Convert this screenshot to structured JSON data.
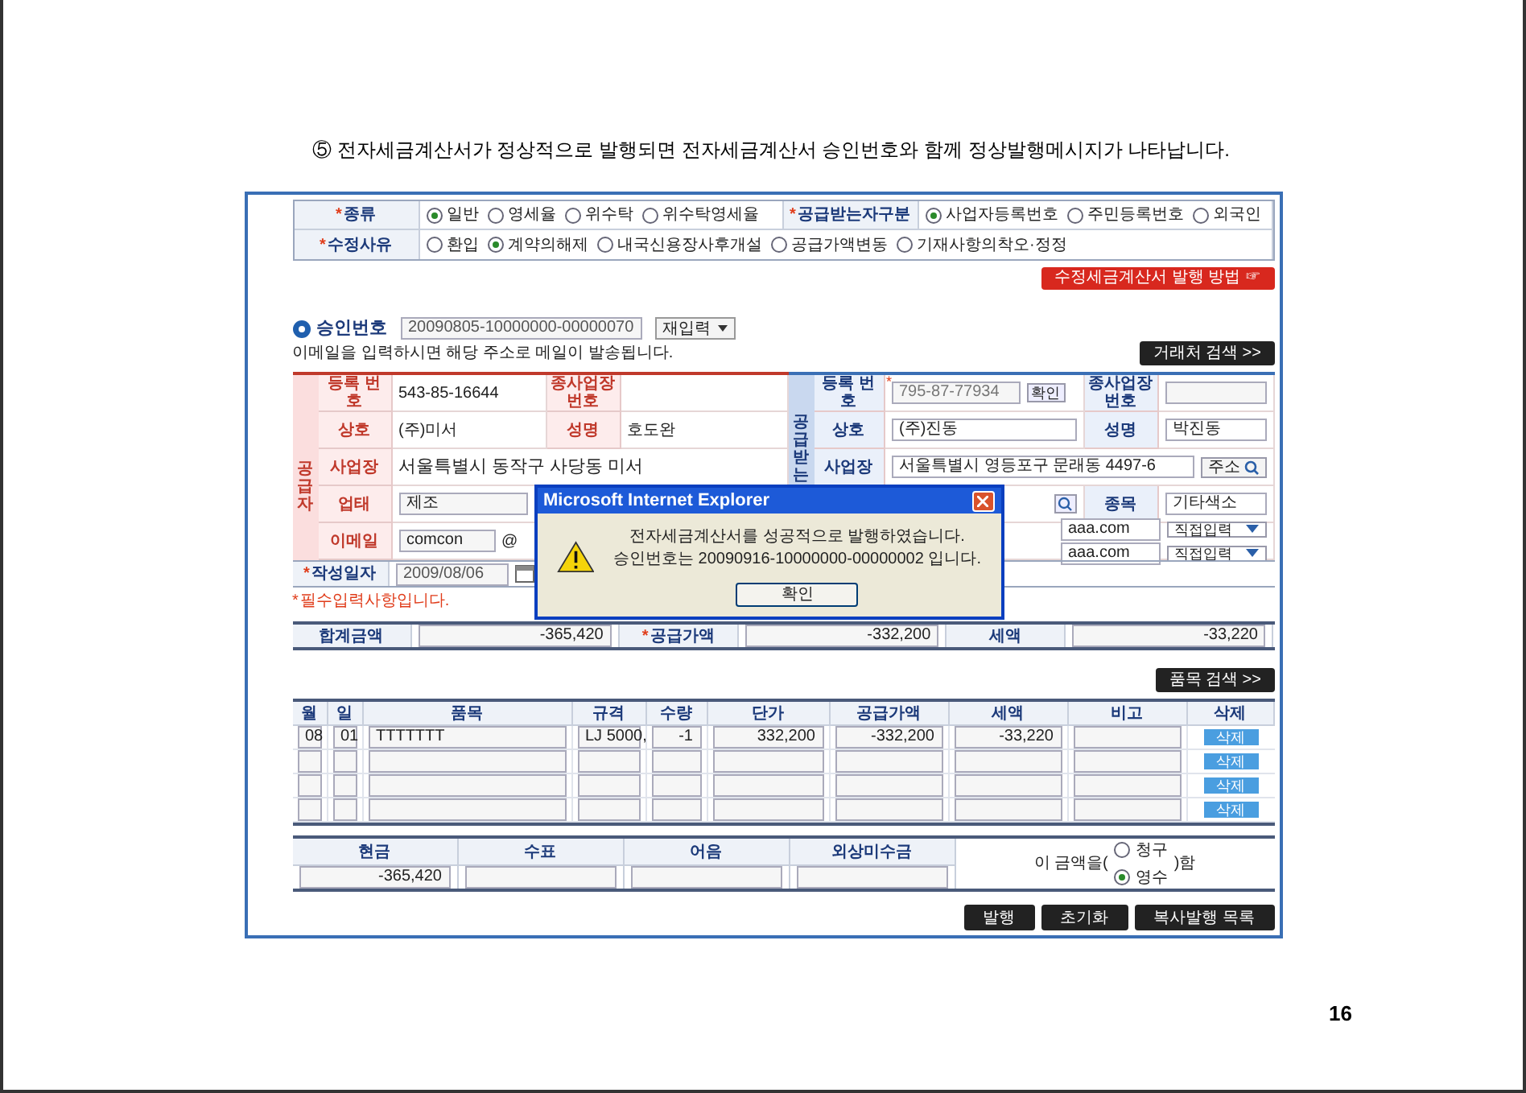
{
  "heading": "⑤ 전자세금계산서가 정상적으로 발행되면 전자세금계산서 승인번호와 함께 정상발행메시지가 나타납니다.",
  "option_rows": [
    {
      "groups": [
        {
          "mark": "*",
          "label": "종류",
          "choices": [
            {
              "label": "일반",
              "selected": true
            },
            {
              "label": "영세율",
              "selected": false
            },
            {
              "label": "위수탁",
              "selected": false
            },
            {
              "label": "위수탁영세율",
              "selected": false
            }
          ]
        },
        {
          "mark": "*",
          "label": "공급받는자구분",
          "choices": [
            {
              "label": "사업자등록번호",
              "selected": true
            },
            {
              "label": "주민등록번호",
              "selected": false
            },
            {
              "label": "외국인",
              "selected": false
            }
          ]
        }
      ]
    },
    {
      "groups": [
        {
          "mark": "*",
          "label": "수정사유",
          "choices": [
            {
              "label": "환입",
              "selected": false
            },
            {
              "label": "계약의해제",
              "selected": true
            },
            {
              "label": "내국신용장사후개설",
              "selected": false
            },
            {
              "label": "공급가액변동",
              "selected": false
            },
            {
              "label": "기재사항의착오·정정",
              "selected": false
            }
          ]
        }
      ]
    }
  ],
  "guide_button": "수정세금계산서 발행 방법 ☞",
  "approval": {
    "label": "승인번호",
    "value": "20090805-10000000-00000070",
    "reissue": "재입력"
  },
  "email_note": "이메일을 입력하시면 해당 주소로 메일이 발송됩니다.",
  "partner_search": "거래처 검색 >>",
  "supplier": {
    "title": "공급자",
    "reg_label": "등록 번호",
    "reg": "543-85-16644",
    "branch_label": "종사업장 번호",
    "name_label": "상호",
    "name": "(주)미서",
    "ceo_label": "성명",
    "ceo": "호도완",
    "addr_label": "사업장",
    "addr": "서울특별시 동작구 사당동 미서",
    "type_label": "업태",
    "type": "제조",
    "email_label": "이메일",
    "email": "comcon",
    "at": "@"
  },
  "receiver": {
    "title": "공급받는",
    "mark": "*",
    "reg_label": "등록 번호",
    "reg": "795-87-77934",
    "confirm": "확인",
    "branch_label": "종사업장 번호",
    "name_label": "상호",
    "name": "(주)진동",
    "ceo_label": "성명",
    "ceo": "박진동",
    "addr_label": "사업장",
    "addr": "서울특별시 영등포구 문래동 4497-6",
    "addr_button": "주소",
    "item_label": "종목",
    "item": "기타색소",
    "emails": [
      {
        "domain": "aaa.com",
        "select": "직접입력"
      },
      {
        "domain": "aaa.com",
        "select": "직접입력"
      }
    ]
  },
  "date": {
    "mark": "*",
    "label": "작성일자",
    "value": "2009/08/06"
  },
  "required_note": {
    "mark": "*",
    "text": "필수입력사항입니다."
  },
  "totals": [
    {
      "label": "합계금액",
      "value": "-365,420"
    },
    {
      "mark": "*",
      "label": "공급가액",
      "value": "-332,200"
    },
    {
      "label": "세액",
      "value": "-33,220"
    }
  ],
  "item_search": "품목 검색 >>",
  "items": {
    "columns": [
      "월",
      "일",
      "품목",
      "규격",
      "수량",
      "단가",
      "공급가액",
      "세액",
      "비고",
      "삭제"
    ],
    "rows": [
      {
        "cells": [
          "08",
          "01",
          "TTTTTTT",
          "LJ 5000,",
          "-1",
          "332,200",
          "-332,200",
          "-33,220"
        ],
        "delete": "삭제"
      },
      {
        "delete": "삭제"
      },
      {
        "delete": "삭제"
      },
      {
        "delete": "삭제"
      }
    ]
  },
  "payment": {
    "columns": [
      "현금",
      "수표",
      "어음",
      "외상미수금"
    ],
    "values": [
      "-365,420"
    ],
    "prefix": "이 금액을(",
    "choices": [
      {
        "label": "청구",
        "selected": false
      },
      {
        "label": "영수",
        "selected": true
      }
    ],
    "suffix": ")함"
  },
  "buttons": [
    "발행",
    "초기화",
    "복사발행 목록"
  ],
  "dialog": {
    "title": "Microsoft Internet Explorer",
    "lines": [
      "전자세금계산서를 성공적으로 발행하였습니다.",
      "승인번호는 20090916-10000000-00000002 입니다."
    ],
    "button": "확인"
  },
  "page_number": "16"
}
